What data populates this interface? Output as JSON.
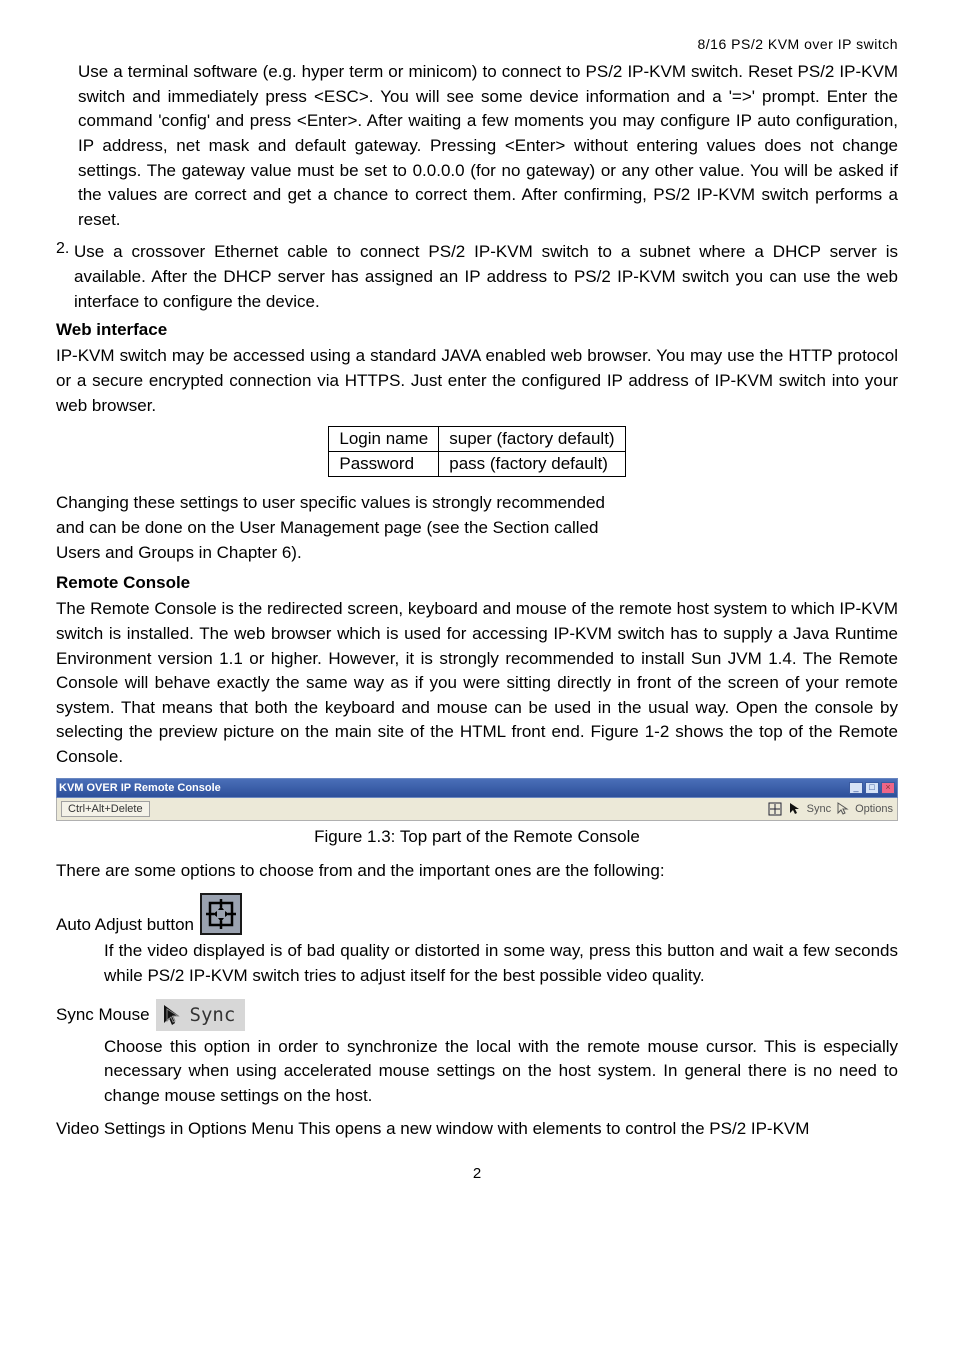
{
  "header": "8/16 PS/2 KVM over IP switch",
  "para1": "Use a terminal software (e.g. hyper term or minicom) to connect to PS/2 IP-KVM switch. Reset PS/2 IP-KVM switch and immediately press <ESC>. You will see some device information and a '=>' prompt. Enter the command 'config' and press <Enter>. After waiting a few moments you may configure IP auto configuration, IP address, net mask and default gateway. Pressing <Enter> without entering values does not change settings. The gateway value must be set to 0.0.0.0 (for no gateway) or any other value. You will be asked if the values are correct and get a chance to correct them. After confirming, PS/2 IP-KVM switch performs a reset.",
  "para2_num": "2.",
  "para2": "Use a crossover Ethernet cable to connect PS/2 IP-KVM switch to a subnet where a DHCP server is available. After the DHCP server has assigned an IP address to PS/2 IP-KVM switch you can use the web interface to configure the device.",
  "web_h": "Web interface",
  "web_p": "IP-KVM switch may be accessed using a standard JAVA enabled web browser. You may use the HTTP protocol or a secure encrypted connection via HTTPS. Just enter the configured IP address of IP-KVM switch into your web browser.",
  "login_table": {
    "r0c0": "Login name",
    "r0c1": "super (factory default)",
    "r1c0": "Password",
    "r1c1": "pass (factory default)"
  },
  "change_p1": "Changing these settings to user specific values is strongly recommended",
  "change_p2": "and can be done on the User Management page (see the Section called",
  "change_p3": "Users and Groups in Chapter 6).",
  "remote_h": "Remote Console",
  "remote_p": "The Remote Console is the redirected screen, keyboard and mouse of the remote host system to which IP-KVM switch is installed. The web browser which is used for accessing IP-KVM switch has to supply a Java Runtime Environment version 1.1 or higher. However, it is strongly recommended to install Sun JVM 1.4. The Remote Console will behave exactly the same way as if you were sitting directly in front of the screen of your remote system. That means that both the keyboard and mouse can be used in the usual way. Open the console by selecting the preview picture on the main site of the HTML front end. Figure 1-2 shows the top of the Remote Console.",
  "console": {
    "title": "KVM OVER IP Remote Console",
    "cad": "Ctrl+Alt+Delete",
    "sync": "Sync",
    "options": "Options"
  },
  "figcap": "Figure 1.3: Top part of the Remote Console",
  "options_p": "There are some options to choose from and the important ones are the following:",
  "aa_label": "Auto Adjust button",
  "aa_desc": "If the video displayed is of bad quality or distorted in some way, press this button and wait a few seconds while PS/2 IP-KVM switch tries to adjust itself for the best possible video quality.",
  "sync_label": "Sync Mouse",
  "sync_btn": "Sync",
  "sync_desc": "Choose this option in order to synchronize the local with the remote mouse cursor. This is especially necessary when using accelerated mouse settings on the host system. In general there is no need to change mouse settings on the host.",
  "video_p": "Video Settings in Options Menu This opens a new window with elements to control the PS/2 IP-KVM",
  "pagenum": "2"
}
